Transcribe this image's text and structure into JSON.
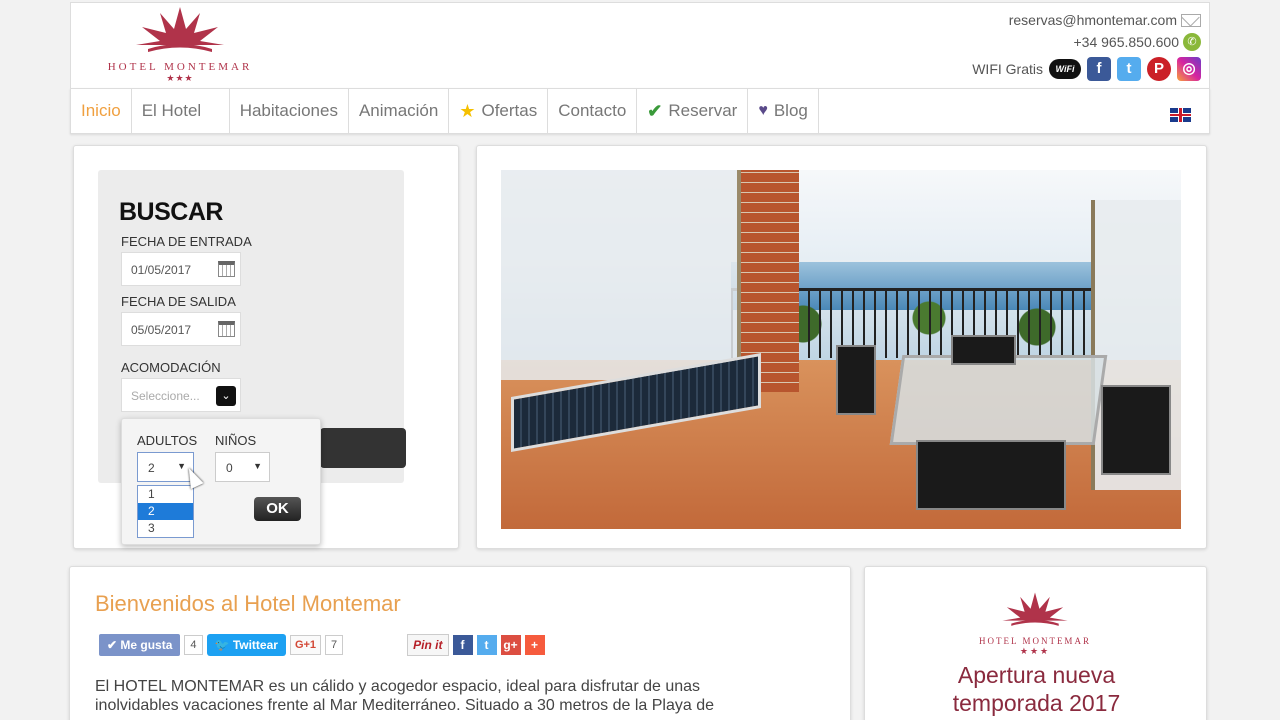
{
  "header": {
    "logo_text": "HOTEL MONTEMAR",
    "logo_stars": "★★★",
    "email": "reservas@hmontemar.com",
    "phone": "+34 965.850.600",
    "wifi_label": "WIFI Gratis",
    "wifi_badge": "WiFi"
  },
  "nav": {
    "items": [
      {
        "label": "Inicio"
      },
      {
        "label": "El Hotel"
      },
      {
        "label": "Habitaciones"
      },
      {
        "label": "Animación"
      },
      {
        "label": "Ofertas"
      },
      {
        "label": "Contacto"
      },
      {
        "label": "Reservar"
      },
      {
        "label": "Blog"
      }
    ]
  },
  "search": {
    "title": "BUSCAR",
    "checkin_label": "FECHA DE ENTRADA",
    "checkin_value": "01/05/2017",
    "checkout_label": "FECHA DE SALIDA",
    "checkout_value": "05/05/2017",
    "accommodation_label": "ACOMODACIÓN",
    "accommodation_placeholder": "Seleccione..."
  },
  "guests": {
    "adults_label": "ADULTOS",
    "adults_value": "2",
    "children_label": "NIÑOS",
    "children_value": "0",
    "adult_options": [
      "1",
      "2",
      "3"
    ],
    "ok_label": "OK"
  },
  "welcome": {
    "title": "Bienvenidos al Hotel Montemar",
    "like_label": "Me gusta",
    "like_count": "4",
    "tweet_label": "Twittear",
    "gplus_label": "G+1",
    "gplus_count": "7",
    "pinit_label": "Pin it",
    "text": "El HOTEL MONTEMAR es un cálido y acogedor espacio, ideal para disfrutar de unas inolvidables vacaciones frente al Mar Mediterráneo. Situado a 30 metros de la Playa de"
  },
  "promo": {
    "logo_text": "HOTEL MONTEMAR",
    "logo_stars": "★★★",
    "line1": "Apertura nueva",
    "line2": "temporada 2017"
  },
  "colors": {
    "accent": "#e8a050",
    "brand": "#b0334a",
    "selected_option": "#1e7bd9"
  }
}
